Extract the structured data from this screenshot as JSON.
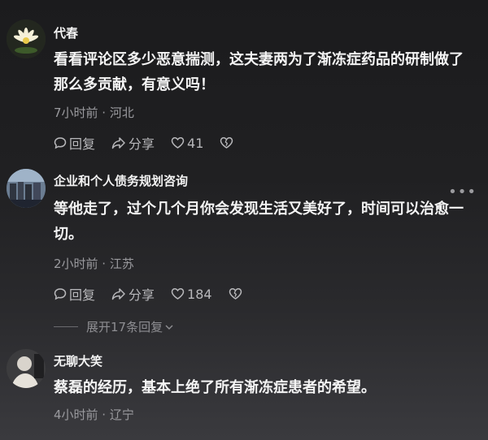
{
  "comments": [
    {
      "author": "代春",
      "text": "看看评论区多少恶意揣测，这夫妻两为了渐冻症药品的研制做了那么多贡献，有意义吗！",
      "meta": "7小时前 · 河北",
      "reply_label": "回复",
      "share_label": "分享",
      "likes": "41"
    },
    {
      "author": "企业和个人债务规划咨询",
      "text": "等他走了，过个几个月你会发现生活又美好了，时间可以治愈一切。",
      "meta": "2小时前 · 江苏",
      "reply_label": "回复",
      "share_label": "分享",
      "likes": "184",
      "more": "•••"
    },
    {
      "author": "无聊大笑",
      "text": "蔡磊的经历，基本上绝了所有渐冻症患者的希望。",
      "meta": "4小时前 · 辽宁"
    }
  ],
  "expand_replies": "展开17条回复",
  "colors": {
    "background": "#1e1e20",
    "text": "#f4f4f4",
    "meta": "#9a9a9e",
    "action": "#b8b8bb"
  }
}
